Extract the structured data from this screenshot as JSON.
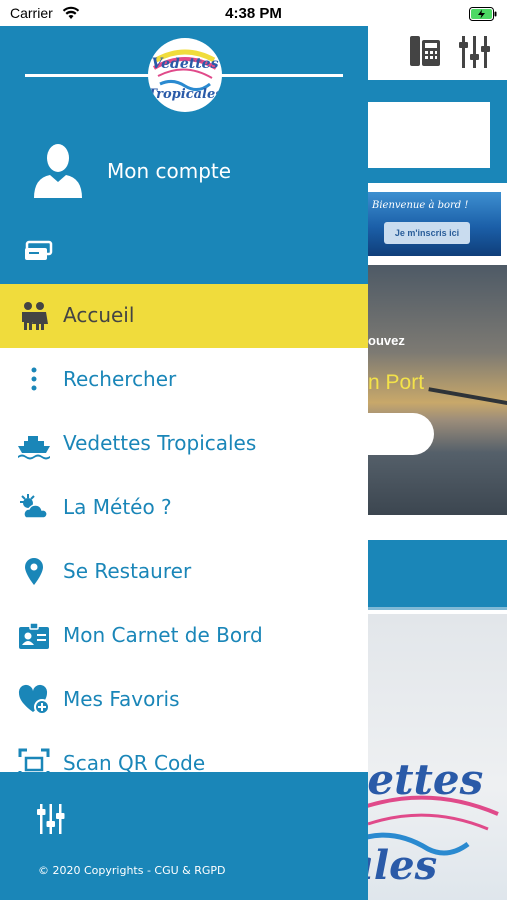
{
  "status_bar": {
    "carrier": "Carrier",
    "time": "4:38 PM"
  },
  "drawer": {
    "logo_alt": "Vedettes Tropicales",
    "account_label": "Mon compte",
    "menu": [
      {
        "label": "Accueil",
        "icon": "family-icon",
        "active": true
      },
      {
        "label": "Rechercher",
        "icon": "more-vertical-icon",
        "active": false
      },
      {
        "label": "Vedettes Tropicales",
        "icon": "ship-icon",
        "active": false
      },
      {
        "label": "La Météo ?",
        "icon": "weather-icon",
        "active": false
      },
      {
        "label": "Se Restaurer",
        "icon": "location-pin-icon",
        "active": false
      },
      {
        "label": "Mon Carnet de Bord",
        "icon": "id-badge-icon",
        "active": false
      },
      {
        "label": "Mes Favoris",
        "icon": "heart-add-icon",
        "active": false
      },
      {
        "label": "Scan QR Code",
        "icon": "qr-scan-icon",
        "active": false
      }
    ],
    "footer_copyright": "© 2020 Copyrights - CGU & RGPD"
  },
  "background": {
    "banner_text": "Bienvenue à bord !",
    "banner_button": "Je m'inscris ici",
    "photo_text_1": "ouvez",
    "photo_text_2": "n Port",
    "logo_text_1": "dettes",
    "logo_text_2": "ales"
  },
  "colors": {
    "brand_blue": "#1a86b8",
    "active_yellow": "#f0dc3c",
    "photo_text_yellow": "#f3e24a"
  }
}
